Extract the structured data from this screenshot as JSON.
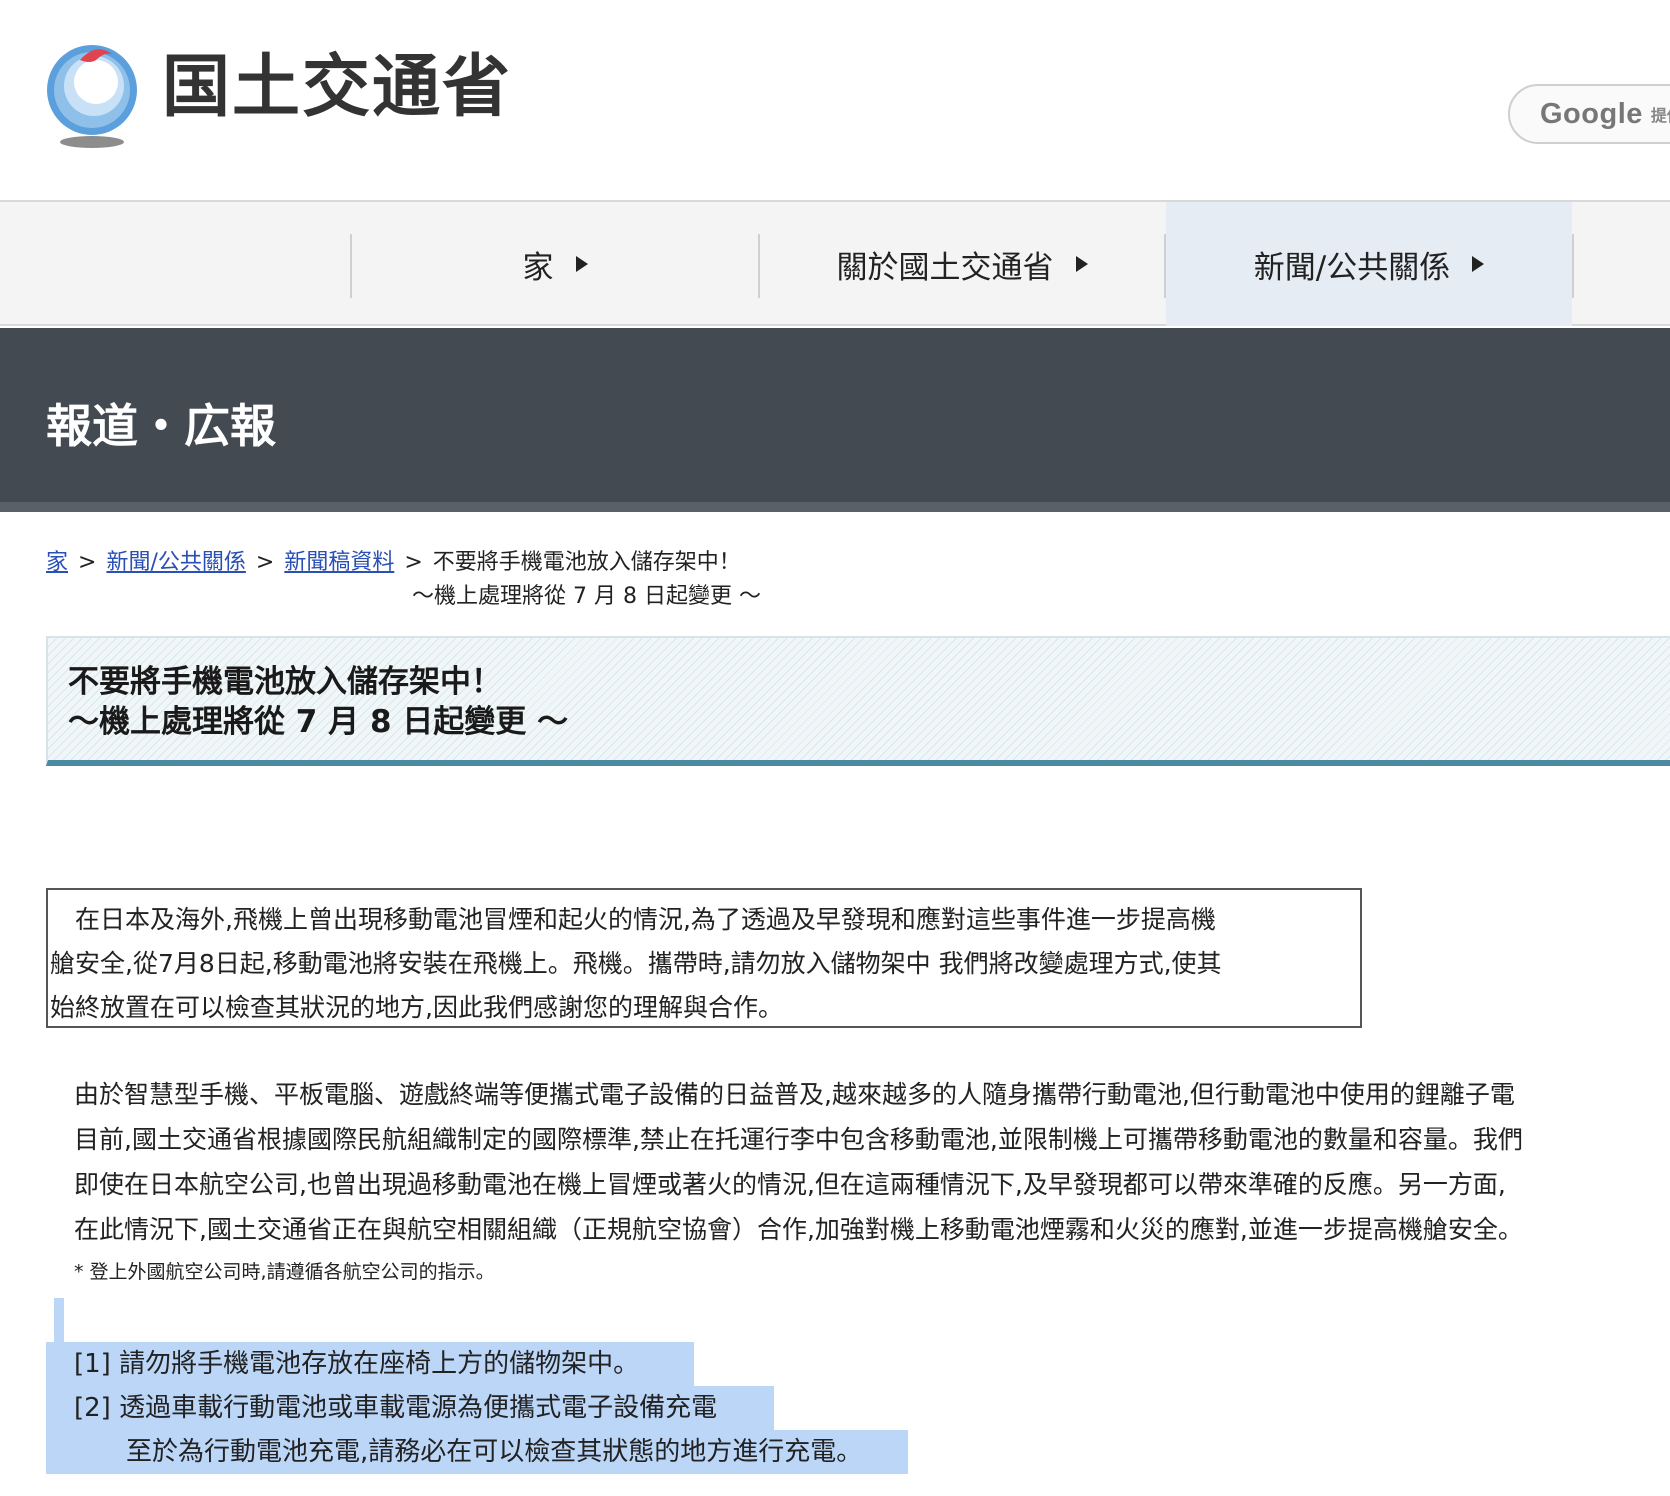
{
  "header": {
    "logo_text": "国土交通省",
    "search": {
      "google": "Google",
      "provided": "提供"
    }
  },
  "nav": {
    "items": [
      {
        "label": "家"
      },
      {
        "label": "關於國土交通省"
      },
      {
        "label": "新聞/公共關係"
      }
    ]
  },
  "banner": {
    "title": "報道・広報"
  },
  "breadcrumb": {
    "home": "家",
    "news": "新聞/公共關係",
    "press": "新聞稿資料",
    "sep": ">",
    "current_line1": "不要將手機電池放入儲存架中！",
    "current_line2": "～機上處理將從 7 月 8 日起變更 ～"
  },
  "title": {
    "line1": "不要將手機電池放入儲存架中！",
    "line2": "～機上處理將從 7 月 8 日起變更 ～"
  },
  "notice": {
    "line1": "　在日本及海外,飛機上曾出現移動電池冒煙和起火的情況,為了透過及早發現和應對這些事件進一步提高機",
    "line2": "艙安全,從7月8日起,移動電池將安裝在飛機上。飛機。攜帶時,請勿放入儲物架中 我們將改變處理方式,使其",
    "line3": "始終放置在可以檢查其狀況的地方,因此我們感謝您的理解與合作。"
  },
  "body": {
    "p1": "由於智慧型手機、平板電腦、遊戲終端等便攜式電子設備的日益普及,越來越多的人隨身攜帶行動電池,但行動電池中使用的鋰離子電",
    "p2": "目前,國土交通省根據國際民航組織制定的國際標準,禁止在托運行李中包含移動電池,並限制機上可攜帶移動電池的數量和容量。我們",
    "p3": "即使在日本航空公司,也曾出現過移動電池在機上冒煙或著火的情況,但在這兩種情況下,及早發現都可以帶來準確的反應。另一方面,",
    "p4": "在此情況下,國土交通省正在與航空相關組織（正規航空協會）合作,加強對機上移動電池煙霧和火災的應對,並進一步提高機艙安全。",
    "footnote": "* 登上外國航空公司時,請遵循各航空公司的指示。"
  },
  "rules": {
    "r1": "[1] 請勿將手機電池存放在座椅上方的儲物架中。",
    "r2": "[2] 透過車載行動電池或車載電源為便攜式電子設備充電",
    "r3": "　　至於為行動電池充電,請務必在可以檢查其狀態的地方進行充電。"
  },
  "colors": {
    "banner_bg": "#434a51",
    "nav_active_bg": "#e6ecf4",
    "link": "#2a4fb5",
    "title_border": "#4b8aa0",
    "selection": "#bcd6f8"
  }
}
